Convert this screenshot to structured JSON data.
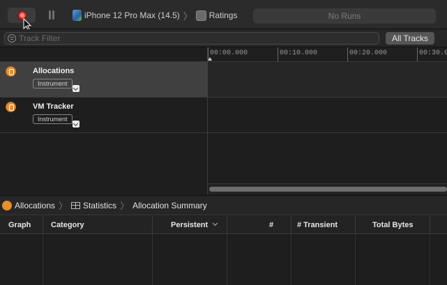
{
  "toolbar": {
    "device_label": "iPhone 12 Pro Max (14.5)",
    "target_label": "Ratings",
    "runs_label": "No Runs"
  },
  "filter": {
    "placeholder": "Track Filter",
    "scope_button": "All Tracks"
  },
  "ruler": {
    "ticks": [
      "00:00.000",
      "00:10.000",
      "00:20.000",
      "00:30.0"
    ]
  },
  "tracks": [
    {
      "name": "Allocations",
      "instrument_label": "Instrument",
      "selected": true
    },
    {
      "name": "VM Tracker",
      "instrument_label": "Instrument",
      "selected": false
    }
  ],
  "breadcrumb": {
    "items": [
      "Allocations",
      "Statistics",
      "Allocation Summary"
    ]
  },
  "table": {
    "columns": [
      "Graph",
      "Category",
      "Persistent",
      "#",
      "# Transient",
      "Total Bytes"
    ],
    "sorted_column": "Persistent"
  },
  "colors": {
    "record": "#e0413a",
    "instrument_orange": "#e88e2a",
    "selected_track": "#404040"
  }
}
